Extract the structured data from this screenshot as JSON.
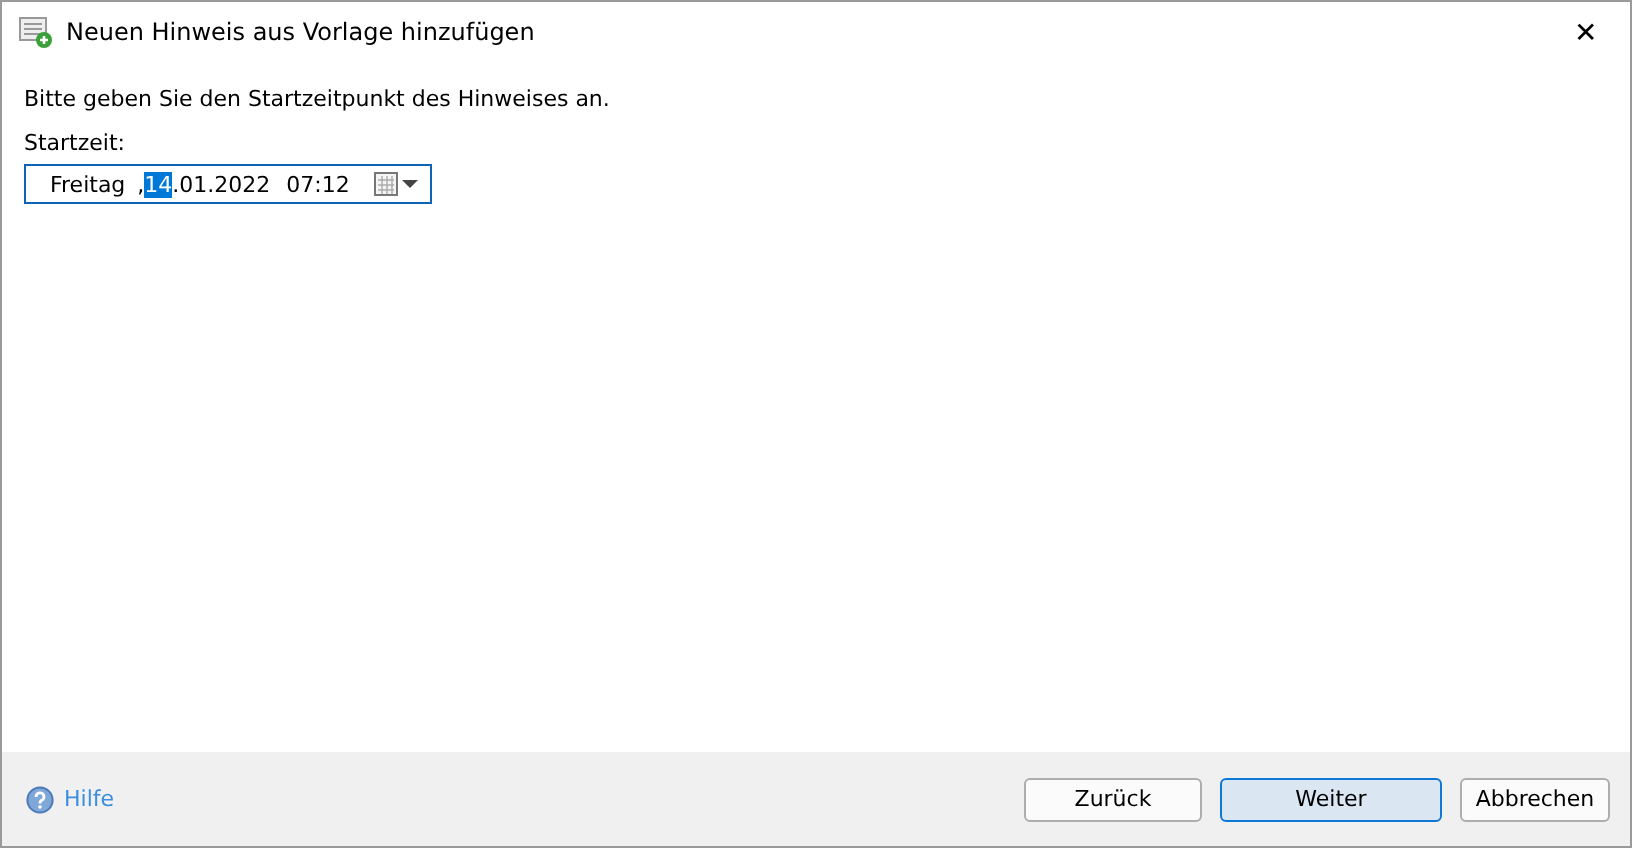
{
  "window": {
    "title": "Neuen Hinweis aus Vorlage hinzufügen",
    "close": "✕"
  },
  "instruction": "Bitte geben Sie den Startzeitpunkt des Hinweises an.",
  "start_field": {
    "label": "Startzeit:",
    "segments": [
      {
        "text": "Freitag",
        "selected": false
      },
      {
        "text": ",",
        "selected": false
      },
      {
        "text": "14",
        "selected": true
      },
      {
        "text": ".01.2022",
        "selected": false
      },
      {
        "text": "07:12",
        "selected": false
      }
    ]
  },
  "footer": {
    "help": "Hilfe",
    "buttons": [
      {
        "label": "Zurück",
        "default": false
      },
      {
        "label": "Weiter",
        "default": true
      },
      {
        "label": "Abbrechen",
        "default": false
      }
    ]
  }
}
